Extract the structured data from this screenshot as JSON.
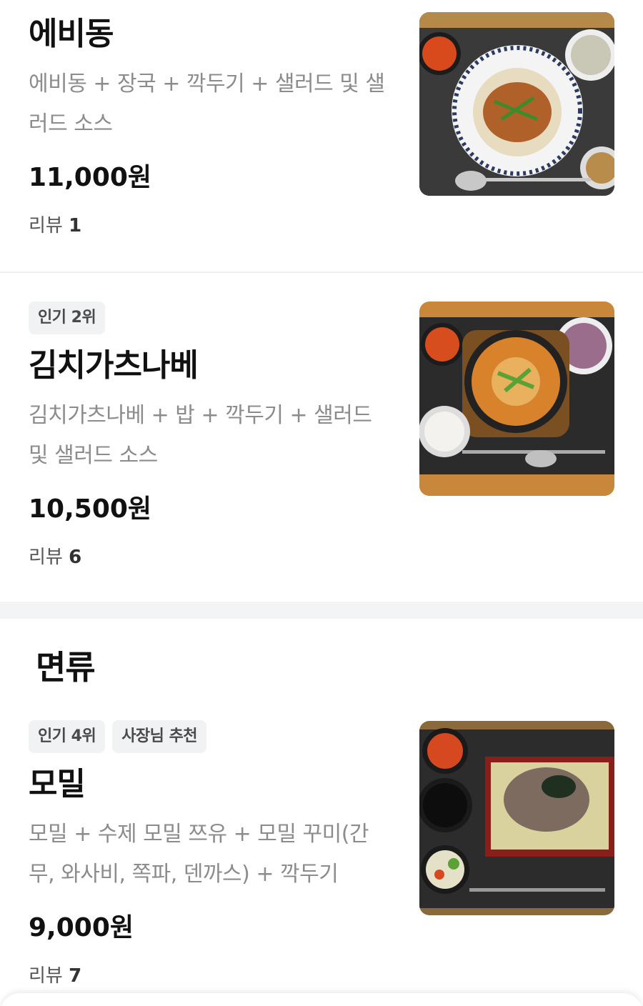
{
  "menu": {
    "items": [
      {
        "badges": [],
        "name": "에비동",
        "description": "에비동 + 장국 + 깍두기 + 샐러드 및 샐러드 소스",
        "price": "11,000원",
        "review_label": "리뷰",
        "review_count": "1",
        "image_icon": "ebi-don-bowl-photo"
      },
      {
        "badges": [
          "인기 2위"
        ],
        "name": "김치가츠나베",
        "description": "김치가츠나베 + 밥 + 깍두기 + 샐러드 및 샐러드 소스",
        "price": "10,500원",
        "review_label": "리뷰",
        "review_count": "6",
        "image_icon": "kimchi-katsu-nabe-photo"
      },
      {
        "badges": [
          "인기 4위",
          "사장님 추천"
        ],
        "name": "모밀",
        "description": "모밀 + 수제 모밀 쯔유 + 모밀 꾸미(간무, 와사비, 쪽파, 덴까스) + 깍두기",
        "price": "9,000원",
        "review_label": "리뷰",
        "review_count": "7",
        "image_icon": "cold-soba-photo"
      }
    ]
  },
  "sections": {
    "noodles_title": "면류"
  },
  "colors": {
    "text_primary": "#111111",
    "text_secondary": "#8c8c8c",
    "badge_bg": "#f1f2f4",
    "divider": "#f3f4f6"
  }
}
